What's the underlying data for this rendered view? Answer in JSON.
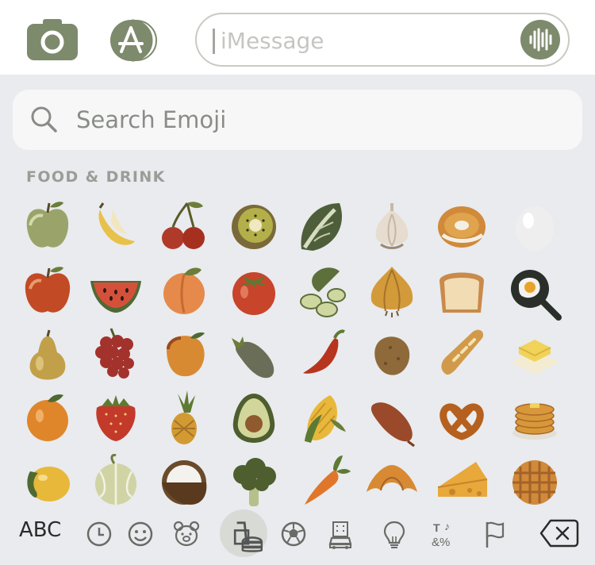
{
  "message_bar": {
    "placeholder": "iMessage",
    "camera_icon": "camera-icon",
    "apps_icon": "app-store-icon",
    "audio_icon": "audio-waveform-icon"
  },
  "search": {
    "placeholder": "Search Emoji",
    "icon": "search-icon"
  },
  "section": {
    "title": "FOOD & DRINK"
  },
  "emojis": [
    [
      "green-apple",
      "banana",
      "cherries",
      "kiwi",
      "leafy-green",
      "garlic",
      "bagel",
      "egg"
    ],
    [
      "red-apple",
      "watermelon",
      "peach",
      "tomato",
      "cucumber",
      "onion",
      "bread",
      "cooking"
    ],
    [
      "pear",
      "grapes",
      "mango",
      "eggplant",
      "hot-pepper",
      "potato",
      "baguette",
      "butter"
    ],
    [
      "tangerine",
      "strawberry",
      "pineapple",
      "avocado",
      "corn",
      "sweet-potato",
      "pretzel",
      "pancakes"
    ],
    [
      "lemon",
      "melon",
      "coconut",
      "broccoli",
      "carrot",
      "croissant",
      "cheese",
      "waffle"
    ]
  ],
  "categories": {
    "abc_label": "ABC",
    "items": [
      "recent-clock-icon",
      "smiley-icon",
      "bear-icon",
      "food-icon",
      "soccer-ball-icon",
      "travel-icon",
      "lightbulb-icon",
      "symbols-icon",
      "flag-icon"
    ],
    "selected": "food-icon",
    "delete_icon": "delete-key-icon"
  },
  "colors": {
    "accent": "#7d8a6c",
    "keyboard_bg": "#e9ebee",
    "text_muted": "#9a9d97"
  }
}
